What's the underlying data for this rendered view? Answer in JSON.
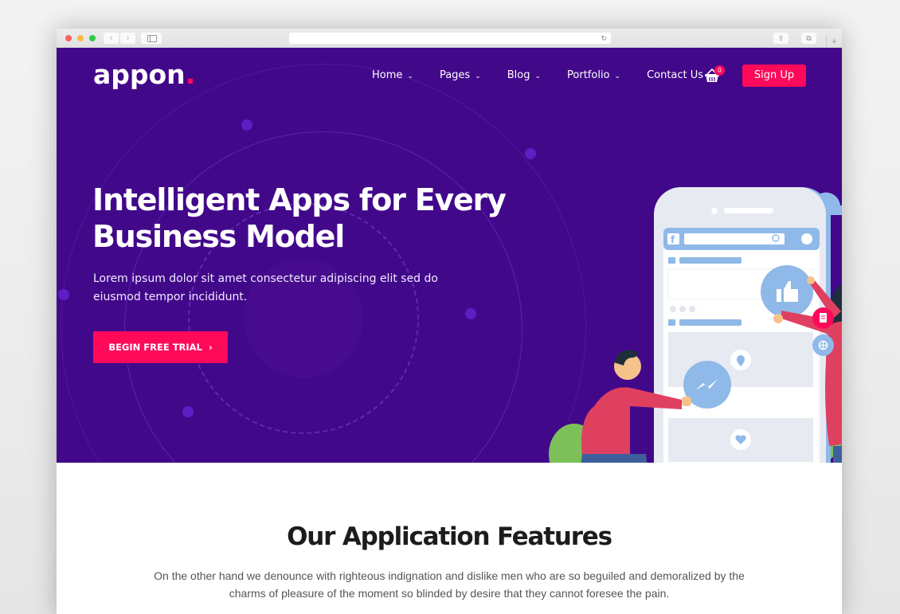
{
  "browser": {
    "nav_back_icon": "chevron-left-icon",
    "nav_forward_icon": "chevron-right-icon",
    "reload_icon": "reload-icon",
    "back_glyph": "‹",
    "forward_glyph": "›",
    "reload_glyph": "↻",
    "share_glyph": "⇪",
    "tabs_glyph": "⧉",
    "newtab_glyph": "+"
  },
  "header": {
    "logo_text": "appon",
    "logo_dot": ".",
    "menu": [
      {
        "label": "Home",
        "has_dropdown": true
      },
      {
        "label": "Pages",
        "has_dropdown": true
      },
      {
        "label": "Blog",
        "has_dropdown": true
      },
      {
        "label": "Portfolio",
        "has_dropdown": true
      },
      {
        "label": "Contact Us",
        "has_dropdown": false
      }
    ],
    "chevron_glyph": "⌄",
    "cart_count": "0",
    "signup_label": "Sign Up"
  },
  "hero": {
    "title": "Intelligent Apps for Every Business Model",
    "subtitle": "Lorem ipsum dolor sit amet consectetur adipiscing elit sed do eiusmod tempor incididunt.",
    "cta_label": "BEGIN FREE TRIAL",
    "cta_arrow": "›"
  },
  "colors": {
    "hero_bg": "#42088a",
    "accent": "#ff0a5a",
    "illustration_blue": "#8fb9e8"
  },
  "features": {
    "title": "Our Application Features",
    "description": "On the other hand we denounce with righteous indignation and dislike men who are so beguiled and demoralized by the charms of pleasure of the moment so blinded by desire that they cannot foresee the pain."
  }
}
